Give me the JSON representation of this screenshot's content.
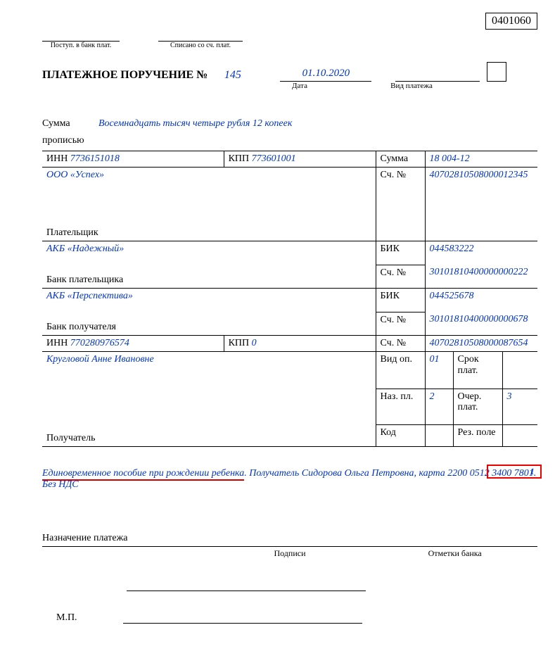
{
  "okud": "0401060",
  "header": {
    "postup_label": "Поступ. в банк плат.",
    "spisano_label": "Списано со сч. плат."
  },
  "title": "ПЛАТЕЖНОЕ ПОРУЧЕНИЕ №",
  "doc_number": "145",
  "doc_date": "01.10.2020",
  "date_label": "Дата",
  "pay_kind_label": "Вид платежа",
  "sum_words_label1": "Сумма",
  "sum_words_label2": "прописью",
  "sum_words": "Восемнадцать тысяч четыре рубля 12 копеек",
  "payer": {
    "inn_label": "ИНН",
    "inn": "7736151018",
    "kpp_label": "КПП",
    "kpp": "773601001",
    "sum_label": "Сумма",
    "sum": "18 004-12",
    "name": "ООО «Успех»",
    "acc_label": "Сч. №",
    "acc": "40702810508000012345",
    "payer_label": "Плательщик"
  },
  "payer_bank": {
    "name": "АКБ «Надежный»",
    "bik_label": "БИК",
    "bik": "044583222",
    "acc_label": "Сч. №",
    "acc": "30101810400000000222",
    "bank_label": "Банк плательщика"
  },
  "recv_bank": {
    "name": "АКБ «Перспектива»",
    "bik_label": "БИК",
    "bik": "044525678",
    "acc_label": "Сч. №",
    "acc": "30101810400000000678",
    "bank_label": "Банк получателя"
  },
  "recv": {
    "inn_label": "ИНН",
    "inn": "770280976574",
    "kpp_label": "КПП",
    "kpp": "0",
    "acc_label": "Сч. №",
    "acc": "40702810508000087654",
    "name": "Кругловой Анне Ивановне",
    "vid_op_label": "Вид оп.",
    "vid_op": "01",
    "srok_label": "Срок плат.",
    "naz_pl_label": "Наз. пл.",
    "naz_pl": "2",
    "ocher_label": "Очер. плат.",
    "ocher": "3",
    "kod_label": "Код",
    "rez_label": "Рез. поле",
    "recv_label": "Получатель"
  },
  "highlighted_num": "1",
  "purpose_underlined": "Единовременное пособие при рождении ребенка",
  "purpose_rest": ". Получатель Сидорова Ольга Петровна, карта 2200 0512 3400 7801. Без НДС",
  "footer": {
    "nazpl": "Назначение платежа",
    "podpisi": "Подписи",
    "otmetki": "Отметки банка",
    "mp": "М.П."
  }
}
